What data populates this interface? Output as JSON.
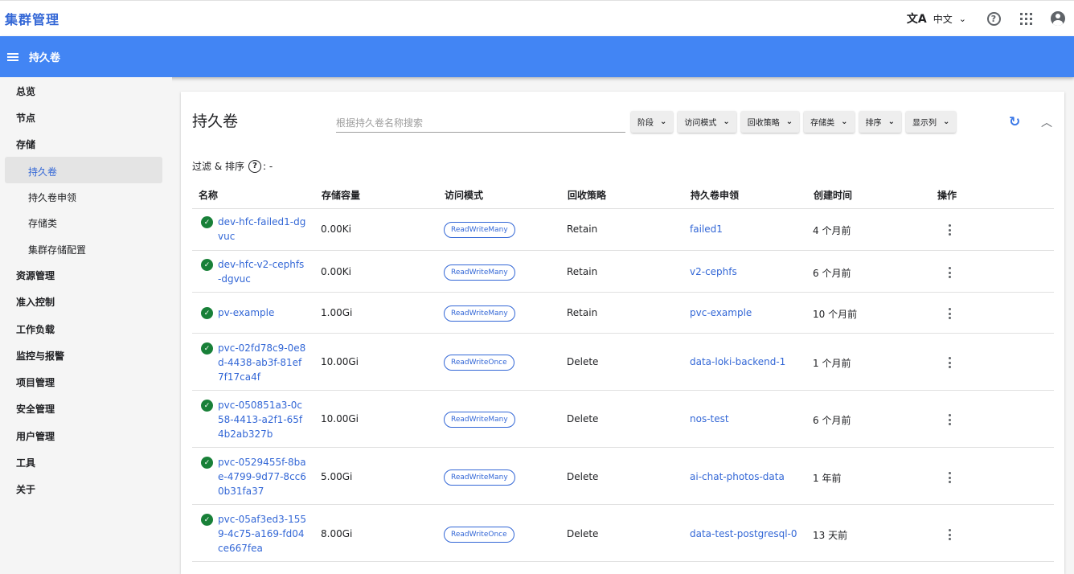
{
  "app": {
    "title": "集群管理"
  },
  "topbar": {
    "language": "中文"
  },
  "header": {
    "title": "持久卷"
  },
  "sidebar": {
    "items": [
      "总览",
      "节点",
      "存储"
    ],
    "storage_sub": [
      "持久卷",
      "持久卷申领",
      "存储类",
      "集群存储配置"
    ],
    "items_after": [
      "资源管理",
      "准入控制",
      "工作负载",
      "监控与报警",
      "项目管理",
      "安全管理",
      "用户管理",
      "工具",
      "关于"
    ]
  },
  "main": {
    "title": "持久卷",
    "search_placeholder": "根据持久卷名称搜索",
    "filters": [
      "阶段",
      "访问模式",
      "回收策略",
      "存储类",
      "排序",
      "显示列"
    ],
    "filter_sort_label": "过滤 & 排序",
    "filter_sort_value": "-"
  },
  "table": {
    "columns": [
      "名称",
      "存储容量",
      "访问模式",
      "回收策略",
      "持久卷申领",
      "创建时间",
      "操作"
    ],
    "rows": [
      {
        "name": "dev-hfc-failed1-dgvuc",
        "capacity": "0.00Ki",
        "access": "ReadWriteMany",
        "reclaim": "Retain",
        "claim": "failed1",
        "created": "4 个月前"
      },
      {
        "name": "dev-hfc-v2-cephfs-dgvuc",
        "capacity": "0.00Ki",
        "access": "ReadWriteMany",
        "reclaim": "Retain",
        "claim": "v2-cephfs",
        "created": "6 个月前"
      },
      {
        "name": "pv-example",
        "capacity": "1.00Gi",
        "access": "ReadWriteMany",
        "reclaim": "Retain",
        "claim": "pvc-example",
        "created": "10 个月前"
      },
      {
        "name": "pvc-02fd78c9-0e8d-4438-ab3f-81ef7f17ca4f",
        "capacity": "10.00Gi",
        "access": "ReadWriteOnce",
        "reclaim": "Delete",
        "claim": "data-loki-backend-1",
        "created": "1 个月前"
      },
      {
        "name": "pvc-050851a3-0c58-4413-a2f1-65f4b2ab327b",
        "capacity": "10.00Gi",
        "access": "ReadWriteMany",
        "reclaim": "Delete",
        "claim": "nos-test",
        "created": "6 个月前"
      },
      {
        "name": "pvc-0529455f-8bae-4799-9d77-8cc60b31fa37",
        "capacity": "5.00Gi",
        "access": "ReadWriteMany",
        "reclaim": "Delete",
        "claim": "ai-chat-photos-data",
        "created": "1 年前"
      },
      {
        "name": "pvc-05af3ed3-1559-4c75-a169-fd04ce667fea",
        "capacity": "8.00Gi",
        "access": "ReadWriteOnce",
        "reclaim": "Delete",
        "claim": "data-test-postgresql-0",
        "created": "13 天前"
      }
    ]
  },
  "colors": {
    "accent": "#4285f4",
    "link": "#3367d6",
    "success": "#188038"
  }
}
